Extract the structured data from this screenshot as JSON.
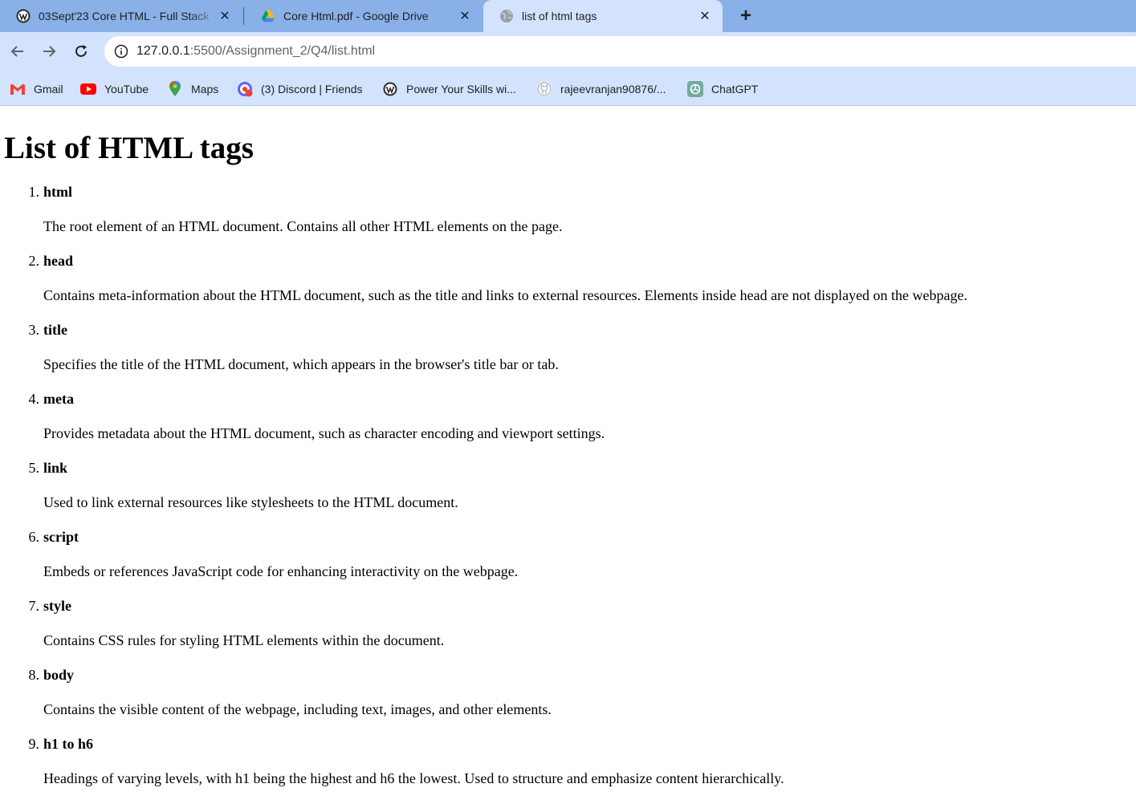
{
  "browser": {
    "tabs": [
      {
        "title": "03Sept'23 Core HTML - Full Stack",
        "icon": "wordpress-icon"
      },
      {
        "title": "Core Html.pdf - Google Drive",
        "icon": "google-drive-icon"
      },
      {
        "title": "list of html tags",
        "icon": "globe-icon",
        "active": true
      }
    ],
    "new_tab_symbol": "+",
    "close_symbol": "✕",
    "address_bar": {
      "host": "127.0.0.1",
      "path": ":5500/Assignment_2/Q4/list.html"
    },
    "bookmarks": [
      {
        "label": "Gmail",
        "icon": "gmail-icon"
      },
      {
        "label": "YouTube",
        "icon": "youtube-icon"
      },
      {
        "label": "Maps",
        "icon": "maps-icon"
      },
      {
        "label": "(3) Discord | Friends",
        "icon": "discord-icon"
      },
      {
        "label": "Power Your Skills wi...",
        "icon": "wordpress-icon"
      },
      {
        "label": "rajeevranjan90876/...",
        "icon": "github-icon"
      },
      {
        "label": "ChatGPT",
        "icon": "chatgpt-icon"
      }
    ]
  },
  "page": {
    "heading": "List of HTML tags",
    "items": [
      {
        "number": "1.",
        "tag": "html",
        "description": "The root element of an HTML document. Contains all other HTML elements on the page."
      },
      {
        "number": "2.",
        "tag": "head",
        "description": "Contains meta-information about the HTML document, such as the title and links to external resources. Elements inside head are not displayed on the webpage."
      },
      {
        "number": "3.",
        "tag": "title",
        "description": "Specifies the title of the HTML document, which appears in the browser's title bar or tab."
      },
      {
        "number": "4.",
        "tag": "meta",
        "description": "Provides metadata about the HTML document, such as character encoding and viewport settings."
      },
      {
        "number": "5.",
        "tag": "link",
        "description": "Used to link external resources like stylesheets to the HTML document."
      },
      {
        "number": "6.",
        "tag": "script",
        "description": "Embeds or references JavaScript code for enhancing interactivity on the webpage."
      },
      {
        "number": "7.",
        "tag": "style",
        "description": "Contains CSS rules for styling HTML elements within the document."
      },
      {
        "number": "8.",
        "tag": "body",
        "description": "Contains the visible content of the webpage, including text, images, and other elements."
      },
      {
        "number": "9.",
        "tag": "h1 to h6",
        "description": "Headings of varying levels, with h1 being the highest and h6 the lowest. Used to structure and emphasize content hierarchically."
      }
    ]
  }
}
